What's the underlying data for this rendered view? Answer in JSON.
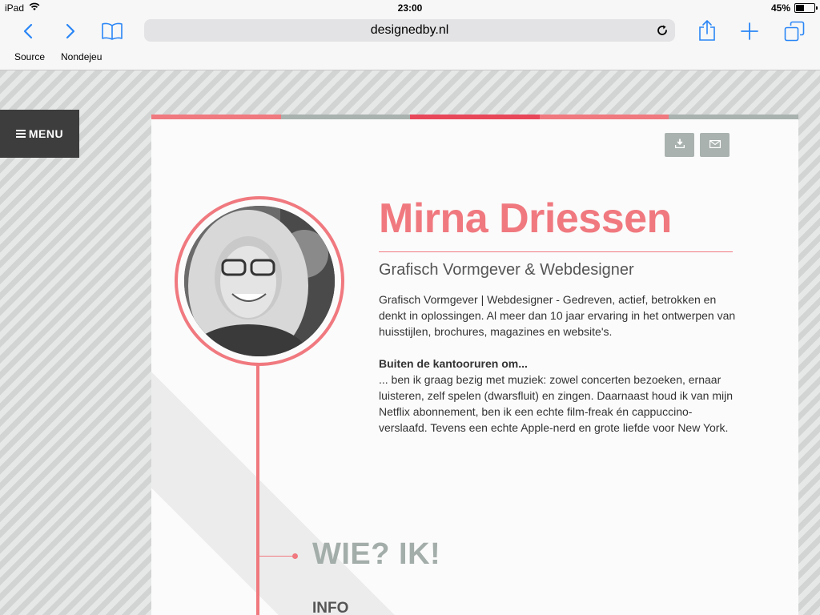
{
  "status_bar": {
    "device": "iPad",
    "time": "23:00",
    "battery": "45%",
    "battery_level": 0.45
  },
  "toolbar": {
    "url": "designedby.nl",
    "bookmarks": [
      "Source",
      "Nondejeu"
    ]
  },
  "page": {
    "menu_label": "MENU",
    "name": "Mirna Driessen",
    "subtitle": "Grafisch Vormgever & Webdesigner",
    "intro": "Grafisch Vormgever | Webdesigner - Gedreven, actief, betrokken en denkt in oplossingen. Al meer dan 10 jaar ervaring in het ontwerpen van huisstijlen, brochures, magazines en website's.",
    "hobby_heading": "Buiten de kantooruren om...",
    "hobby_text": "... ben ik graag bezig met muziek: zowel concerten bezoeken, ernaar luisteren, zelf spelen (dwarsfluit) en zingen. Daarnaast houd ik van mijn Netflix abonnement, ben ik een echte film-freak én cappuccino-verslaafd. Tevens een echte Apple-nerd en grote liefde voor New York.",
    "section_title": "WIE? IK!",
    "info_label": "INFO"
  },
  "colors": {
    "accent": "#f0797f",
    "accent_dark": "#e8475a",
    "gray": "#a9b2ae",
    "ios_blue": "#2a86f6"
  },
  "icons": {
    "back": "chevron-left-icon",
    "forward": "chevron-right-icon",
    "bookmarks": "book-icon",
    "reload": "reload-icon",
    "share": "share-icon",
    "new_tab": "plus-icon",
    "tabs": "tabs-icon",
    "download": "download-icon",
    "email": "envelope-icon"
  }
}
